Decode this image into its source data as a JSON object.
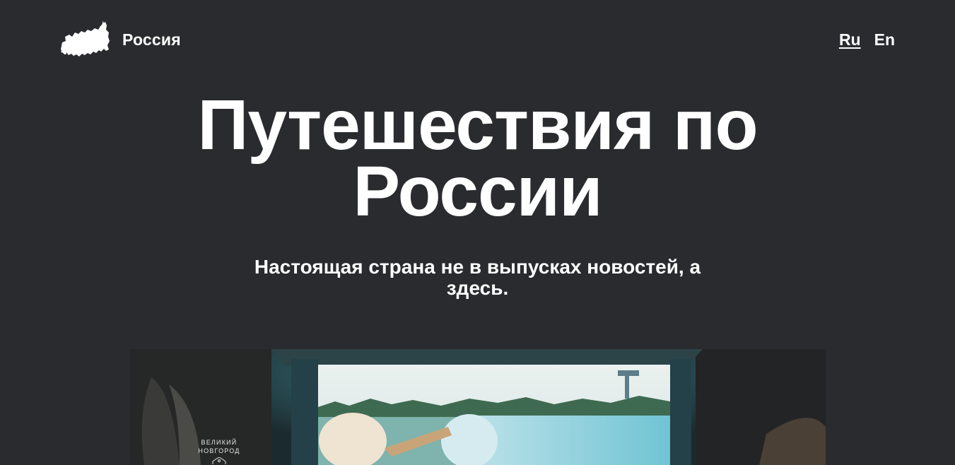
{
  "header": {
    "brand": "Россия",
    "logo_icon": "russia-map-icon",
    "languages": [
      {
        "label": "Ru",
        "active": true
      },
      {
        "label": "En",
        "active": false
      }
    ]
  },
  "hero": {
    "title_line1": "Путешествия по",
    "title_line2": "России",
    "subtitle_line1": "Настоящая страна не в выпусках новостей, а",
    "subtitle_line2": "здесь."
  },
  "feature_image": {
    "city_line1": "ВЕЛИКИЙ",
    "city_line2": "НОВГОРОД",
    "city_icon": "kremlin-emblem-icon"
  },
  "colors": {
    "background": "#2a2b2f",
    "text": "#ffffff"
  }
}
